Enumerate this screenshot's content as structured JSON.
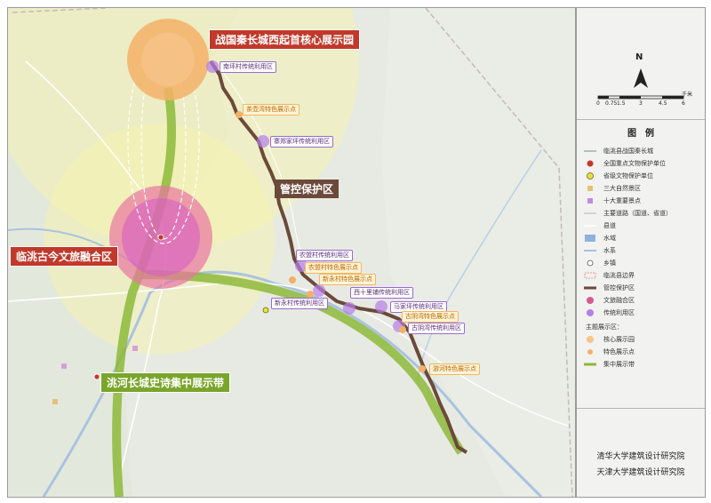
{
  "title_labels": {
    "core_park": "战国秦长城西起首核心展示园",
    "control_zone": "管控保护区",
    "fusion_zone": "临洮古今文旅融合区",
    "belt": "洮河长城史诗集中展示带"
  },
  "point_labels": {
    "purple": [
      "南坪村传统利用区",
      "寨郑家坪传统利用区",
      "农盟村传统利用区",
      "新永村传统利用区",
      "西十里铺传统利用区",
      "马家坪传统利用区",
      "古阴湾传统利用区"
    ],
    "orange": [
      "茶壶湾特色展示点",
      "农盟村特色展示点",
      "新永村特色展示点",
      "古阴湾特色展示点",
      "游河特色展示点"
    ]
  },
  "compass": {
    "north_label": "N"
  },
  "scale_bar": {
    "ticks": [
      "0",
      "0.75",
      "1.5",
      "3",
      "4.5",
      "6"
    ],
    "unit": "千米"
  },
  "legend": {
    "title": "图　例",
    "items": [
      "临洮县战国秦长城",
      "全国重点文物保护单位",
      "省级文物保护单位",
      "三大自然景区",
      "十大重要景点",
      "主要道路（国道、省道）",
      "县道",
      "水域",
      "水系",
      "乡镇",
      "临洮县边界",
      "管控保护区",
      "文旅融合区",
      "传统利用区"
    ],
    "subsection_title": "主题展示区：",
    "sub_items": [
      "核心展示园",
      "特色展示点",
      "集中展示带"
    ]
  },
  "institutes": [
    "清华大学建筑设计研究院",
    "天津大学建筑设计研究院"
  ],
  "colors": {
    "wall_brown": "#6b4a3a",
    "belt_green": "#8db83a",
    "fusion_pink": "#d9468a",
    "core_orange": "#f5b067",
    "purple_point": "#b57ee8",
    "yellow_halo": "#f6f3a9"
  }
}
